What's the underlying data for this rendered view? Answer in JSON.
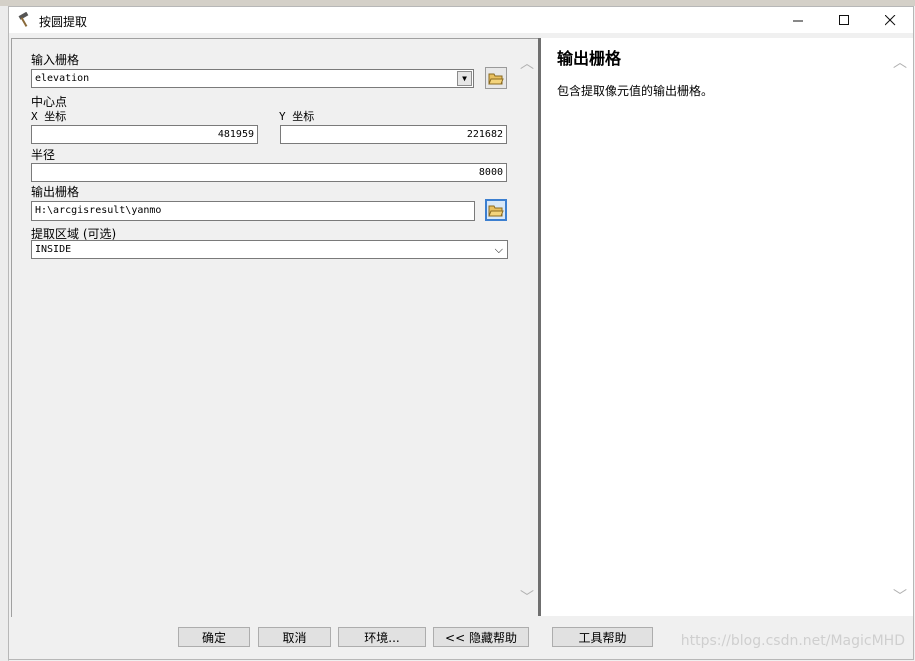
{
  "window": {
    "title": "按圆提取",
    "icon": "hammer-icon"
  },
  "form": {
    "input_raster": {
      "label": "输入栅格",
      "value": "elevation"
    },
    "center": {
      "label": "中心点",
      "x_label": "X 坐标",
      "x_value": "481959",
      "y_label": "Y 坐标",
      "y_value": "221682"
    },
    "radius": {
      "label": "半径",
      "value": "8000"
    },
    "output_raster": {
      "label": "输出栅格",
      "value": "H:\\arcgisresult\\yanmo"
    },
    "extraction_area": {
      "label": "提取区域 (可选)",
      "value": "INSIDE"
    }
  },
  "help": {
    "title": "输出栅格",
    "text": "包含提取像元值的输出栅格。"
  },
  "buttons": {
    "ok": "确定",
    "cancel": "取消",
    "environments": "环境...",
    "hide_help": "<< 隐藏帮助",
    "tool_help": "工具帮助"
  },
  "watermark": "https://blog.csdn.net/MagicMHD",
  "colors": {
    "active_border": "#3c7fd0",
    "divider": "#6f6f6f"
  }
}
